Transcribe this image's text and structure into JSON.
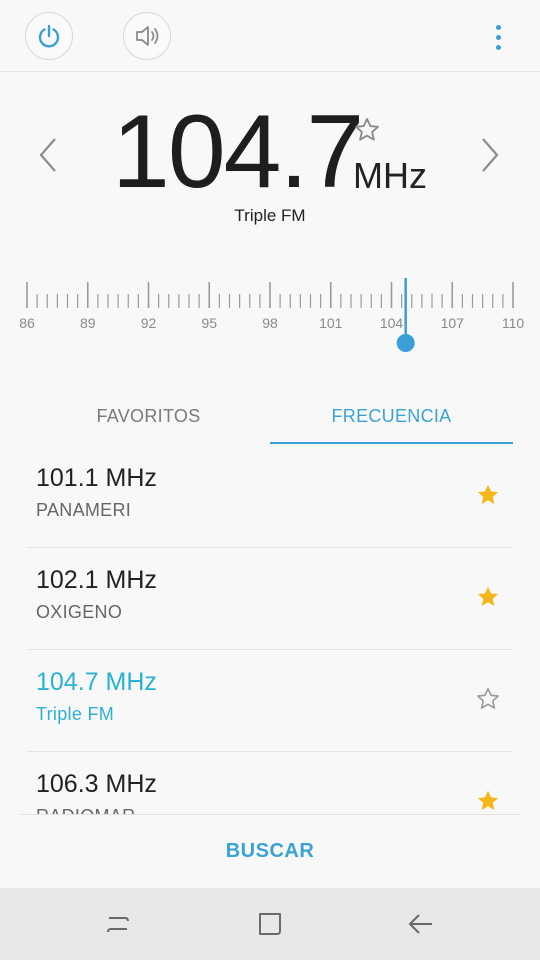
{
  "header": {
    "power_icon": "power-icon",
    "speaker_icon": "speaker-icon",
    "menu_icon": "more-vert-icon",
    "accent": "#3b9fd6"
  },
  "tuner": {
    "frequency": "104.7",
    "unit": "MHz",
    "station": "Triple FM",
    "favorite": false,
    "dial_labels": [
      "86",
      "89",
      "92",
      "95",
      "98",
      "101",
      "104",
      "107",
      "110"
    ],
    "dial_min": 86,
    "dial_max": 110,
    "dial_value": 104.7,
    "indicator_color": "#3b9fd6"
  },
  "tabs": {
    "favorites": "FAVORITOS",
    "frequency": "FRECUENCIA",
    "active": "frequency"
  },
  "stations": [
    {
      "freq": "101.1 MHz",
      "name": "PANAMERI",
      "favorite": true,
      "current": false
    },
    {
      "freq": "102.1 MHz",
      "name": "OXIGENO",
      "favorite": true,
      "current": false
    },
    {
      "freq": "104.7 MHz",
      "name": "Triple FM",
      "favorite": false,
      "current": true
    },
    {
      "freq": "106.3 MHz",
      "name": "RADIOMAR",
      "favorite": true,
      "current": false
    }
  ],
  "actions": {
    "scan": "BUSCAR"
  },
  "colors": {
    "star_filled": "#f5b71c",
    "star_outline": "#9a9a9a",
    "current_station": "#29b2d6"
  }
}
